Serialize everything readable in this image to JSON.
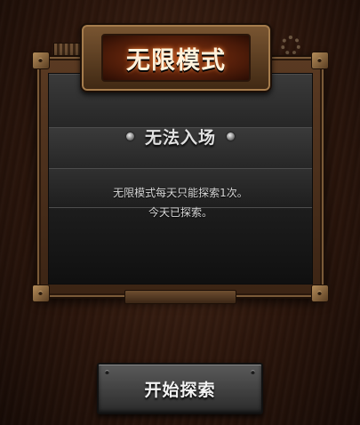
{
  "dialog": {
    "title": "无限模式",
    "subtitle": "无法入场",
    "message_lines": [
      "无限模式每天只能探索1次。",
      "今天已探索。"
    ]
  },
  "start_button": {
    "label": "开始探索"
  },
  "icons": {
    "subtitle_left": "rivet-dot-icon",
    "subtitle_right": "rivet-dot-icon",
    "decor": "gear-icon"
  },
  "colors": {
    "title_glow": "#ff8a3a",
    "frame": "#5a3a22",
    "panel": "#262626"
  }
}
